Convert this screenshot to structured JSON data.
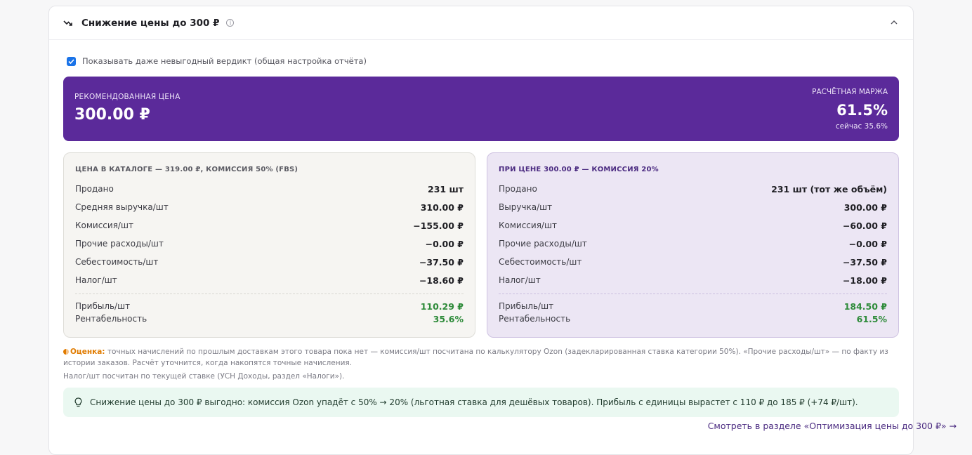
{
  "header": {
    "title": "Снижение цены до 300 ₽",
    "trend_icon": "trending-down-icon",
    "info_icon": "info-icon",
    "collapse_icon": "chevron-up-icon"
  },
  "toggle": {
    "checked": true,
    "label": "Показывать даже невыгодный вердикт (общая настройка отчёта)"
  },
  "banner": {
    "color": "#5b2a9a",
    "rec_label": "РЕКОМЕНДОВАННАЯ ЦЕНА",
    "rec_price": "300.00 ₽",
    "margin_label": "РАСЧЁТНАЯ МАРЖА",
    "margin_value": "61.5%",
    "margin_now": "сейчас 35.6%"
  },
  "left_panel": {
    "title": "ЦЕНА В КАТАЛОГЕ — 319.00 ₽, КОМИССИЯ 50% (FBS)",
    "rows": [
      {
        "k": "Продано",
        "v": "231 шт"
      },
      {
        "k": "Средняя выручка/шт",
        "v": "310.00 ₽"
      },
      {
        "k": "Комиссия/шт",
        "v": "−155.00 ₽"
      },
      {
        "k": "Прочие расходы/шт",
        "v": "−0.00 ₽"
      },
      {
        "k": "Себестоимость/шт",
        "v": "−37.50 ₽"
      },
      {
        "k": "Налог/шт",
        "v": "−18.60 ₽"
      }
    ],
    "profit_label": "Прибыль/шт",
    "profit_value": "110.29 ₽",
    "rent_label": "Рентабельность",
    "rent_value": "35.6%"
  },
  "right_panel": {
    "title": "ПРИ ЦЕНЕ 300.00 ₽ — КОМИССИЯ 20%",
    "rows": [
      {
        "k": "Продано",
        "v": "231 шт (тот же объём)"
      },
      {
        "k": "Выручка/шт",
        "v": "300.00 ₽"
      },
      {
        "k": "Комиссия/шт",
        "v": "−60.00 ₽"
      },
      {
        "k": "Прочие расходы/шт",
        "v": "−0.00 ₽"
      },
      {
        "k": "Себестоимость/шт",
        "v": "−37.50 ₽"
      },
      {
        "k": "Налог/шт",
        "v": "−18.00 ₽"
      }
    ],
    "profit_label": "Прибыль/шт",
    "profit_value": "184.50 ₽",
    "rent_label": "Рентабельность",
    "rent_value": "61.5%"
  },
  "notes": {
    "estimate_label": "Оценка:",
    "estimate_text": " точных начислений по прошлым доставкам этого товара пока нет — комиссия/шт посчитана по калькулятору Ozon (задекларированная ставка категории 50%). «Прочие расходы/шт» — по факту из истории заказов. Расчёт уточнится, когда накопятся точные начисления.",
    "tax_text": "Налог/шт посчитан по текущей ставке (УСН Доходы, раздел «Налоги»)."
  },
  "hint": {
    "icon": "lightbulb-icon",
    "text": "Снижение цены до 300 ₽ выгодно: комиссия Ozon упадёт с 50% → 20% (льготная ставка для дешёвых товаров). Прибыль с единицы вырастет с 110 ₽ до 185 ₽ (+74 ₽/шт)."
  },
  "link": {
    "text": "Смотреть в разделе «Оптимизация цены до 300 ₽» →"
  }
}
